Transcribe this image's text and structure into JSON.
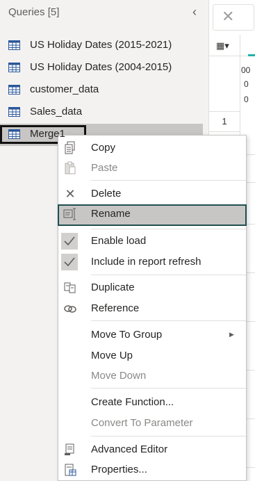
{
  "queries_pane": {
    "title": "Queries [5]",
    "collapse_icon": "chevron-left-icon",
    "items": [
      {
        "label": "US Holiday Dates (2015-2021)",
        "icon": "table-icon"
      },
      {
        "label": "US Holiday Dates (2004-2015)",
        "icon": "table-icon"
      },
      {
        "label": "customer_data",
        "icon": "table-icon"
      },
      {
        "label": "Sales_data",
        "icon": "table-icon"
      },
      {
        "label": "Merge1",
        "icon": "table-icon",
        "selected": true
      }
    ]
  },
  "preview": {
    "close_icon": "close-icon",
    "row_index": "1",
    "partial_values": [
      "00",
      "0",
      "0"
    ]
  },
  "context_menu": {
    "items": [
      {
        "id": "copy",
        "label": "Copy",
        "icon": "copy-icon",
        "disabled": false
      },
      {
        "id": "paste",
        "label": "Paste",
        "icon": "paste-icon",
        "disabled": true
      },
      {
        "id": "delete",
        "label": "Delete",
        "icon": "delete-x-icon",
        "disabled": false
      },
      {
        "id": "rename",
        "label": "Rename",
        "icon": "rename-icon",
        "disabled": false,
        "highlighted": true
      },
      {
        "id": "enable_load",
        "label": "Enable load",
        "icon": "checkmark-icon",
        "checked": true
      },
      {
        "id": "include_refresh",
        "label": "Include in report refresh",
        "icon": "checkmark-icon",
        "checked": true
      },
      {
        "id": "duplicate",
        "label": "Duplicate",
        "icon": "duplicate-icon",
        "disabled": false
      },
      {
        "id": "reference",
        "label": "Reference",
        "icon": "link-icon",
        "disabled": false
      },
      {
        "id": "move_to_group",
        "label": "Move To Group",
        "has_submenu": true
      },
      {
        "id": "move_up",
        "label": "Move Up",
        "disabled": false
      },
      {
        "id": "move_down",
        "label": "Move Down",
        "disabled": true
      },
      {
        "id": "create_function",
        "label": "Create Function...",
        "disabled": false
      },
      {
        "id": "convert_param",
        "label": "Convert To Parameter",
        "disabled": true
      },
      {
        "id": "advanced_editor",
        "label": "Advanced Editor",
        "icon": "advanced-editor-icon"
      },
      {
        "id": "properties",
        "label": "Properties...",
        "icon": "properties-icon"
      }
    ]
  },
  "colors": {
    "pane_bg": "#f3f2f1",
    "selected_bg": "#c8c6c4",
    "highlight_border": "#1f4e4f",
    "accent": "#20b2aa",
    "icon_blue": "#2b579a"
  }
}
